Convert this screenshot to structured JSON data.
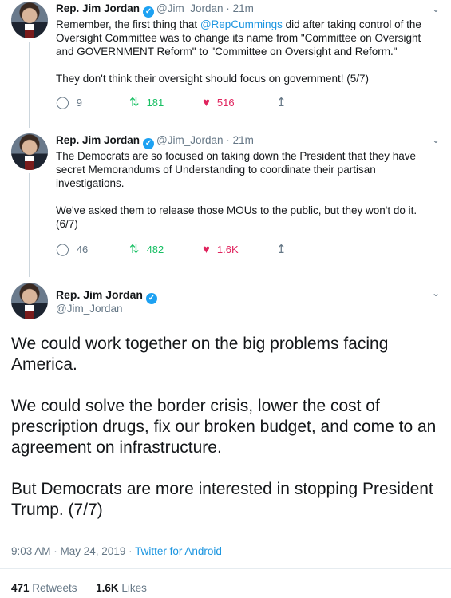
{
  "author": {
    "name": "Rep. Jim Jordan",
    "handle": "@Jim_Jordan",
    "verified_icon": "✓"
  },
  "tweets": [
    {
      "time": "21m",
      "text_pre": "Remember, the first thing that ",
      "mention": "@RepCummings",
      "text_post": " did after taking control of the Oversight Committee was to change its name from \"Committee on Oversight and GOVERNMENT Reform\" to \"Committee on Oversight and Reform.\"",
      "text2": "They don't think their oversight should focus on government! (5/7)",
      "replies": "9",
      "retweets": "181",
      "likes": "516"
    },
    {
      "time": "21m",
      "text": "The Democrats are so focused on taking down the President that they have secret Memorandums of Understanding to coordinate their partisan investigations.",
      "text2": "We've asked them to release those MOUs to the public, but they won't do it. (6/7)",
      "replies": "46",
      "retweets": "482",
      "likes": "1.6K"
    }
  ],
  "main_tweet": {
    "para1": "We could work together on the big problems facing America.",
    "para2": "We could solve the border crisis, lower the cost of prescription drugs, fix our broken budget, and come to an agreement on infrastructure.",
    "para3": "But Democrats are more interested in stopping President Trump. (7/7)",
    "timestamp": "9:03 AM · May 24, 2019 · ",
    "source": "Twitter for Android",
    "retweet_count": "471",
    "retweet_label": " Retweets",
    "like_count": "1.6K",
    "like_label": " Likes"
  },
  "separators": {
    "dot": "·"
  },
  "colors": {
    "accent": "#1da1f2",
    "link": "#1b95e0",
    "retweet": "#17bf63",
    "like": "#e0245e",
    "muted": "#657786"
  }
}
